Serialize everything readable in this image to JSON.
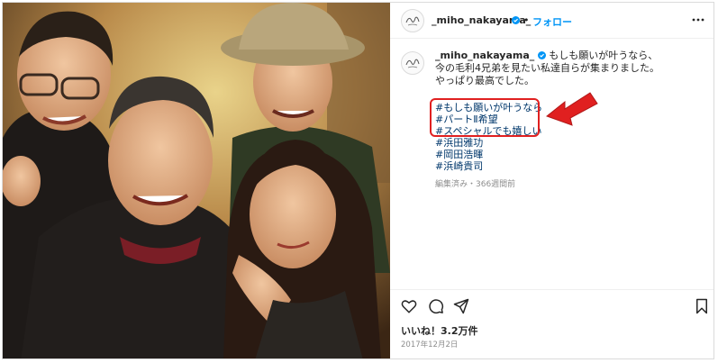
{
  "post": {
    "username": "_miho_nakayama_",
    "separator": "•",
    "follow_label": "フォロー",
    "more_icon": "more-dots-icon",
    "caption_username": "_miho_nakayama_",
    "caption_lines": [
      "もしも願いが叶うなら、",
      "今の毛利4兄弟を見たい私達自らが集まりました。",
      "やっぱり最高でした。"
    ],
    "hashtags": [
      "#もしも願いが叶うなら",
      "#パートⅡ希望",
      "#スペシャルでも嬉しい",
      "#浜田雅功",
      "#岡田浩暉",
      "#浜崎貴司"
    ],
    "edited_text": "編集済み・366週間前",
    "likes_text": "いいね！3.2万件",
    "date_text": "2017年12月2日",
    "icons": [
      "heart-icon",
      "comment-icon",
      "share-icon",
      "bookmark-icon"
    ],
    "colors": {
      "link": "#0095f6",
      "hashtag": "#00376b",
      "annotation": "#e02020"
    }
  }
}
